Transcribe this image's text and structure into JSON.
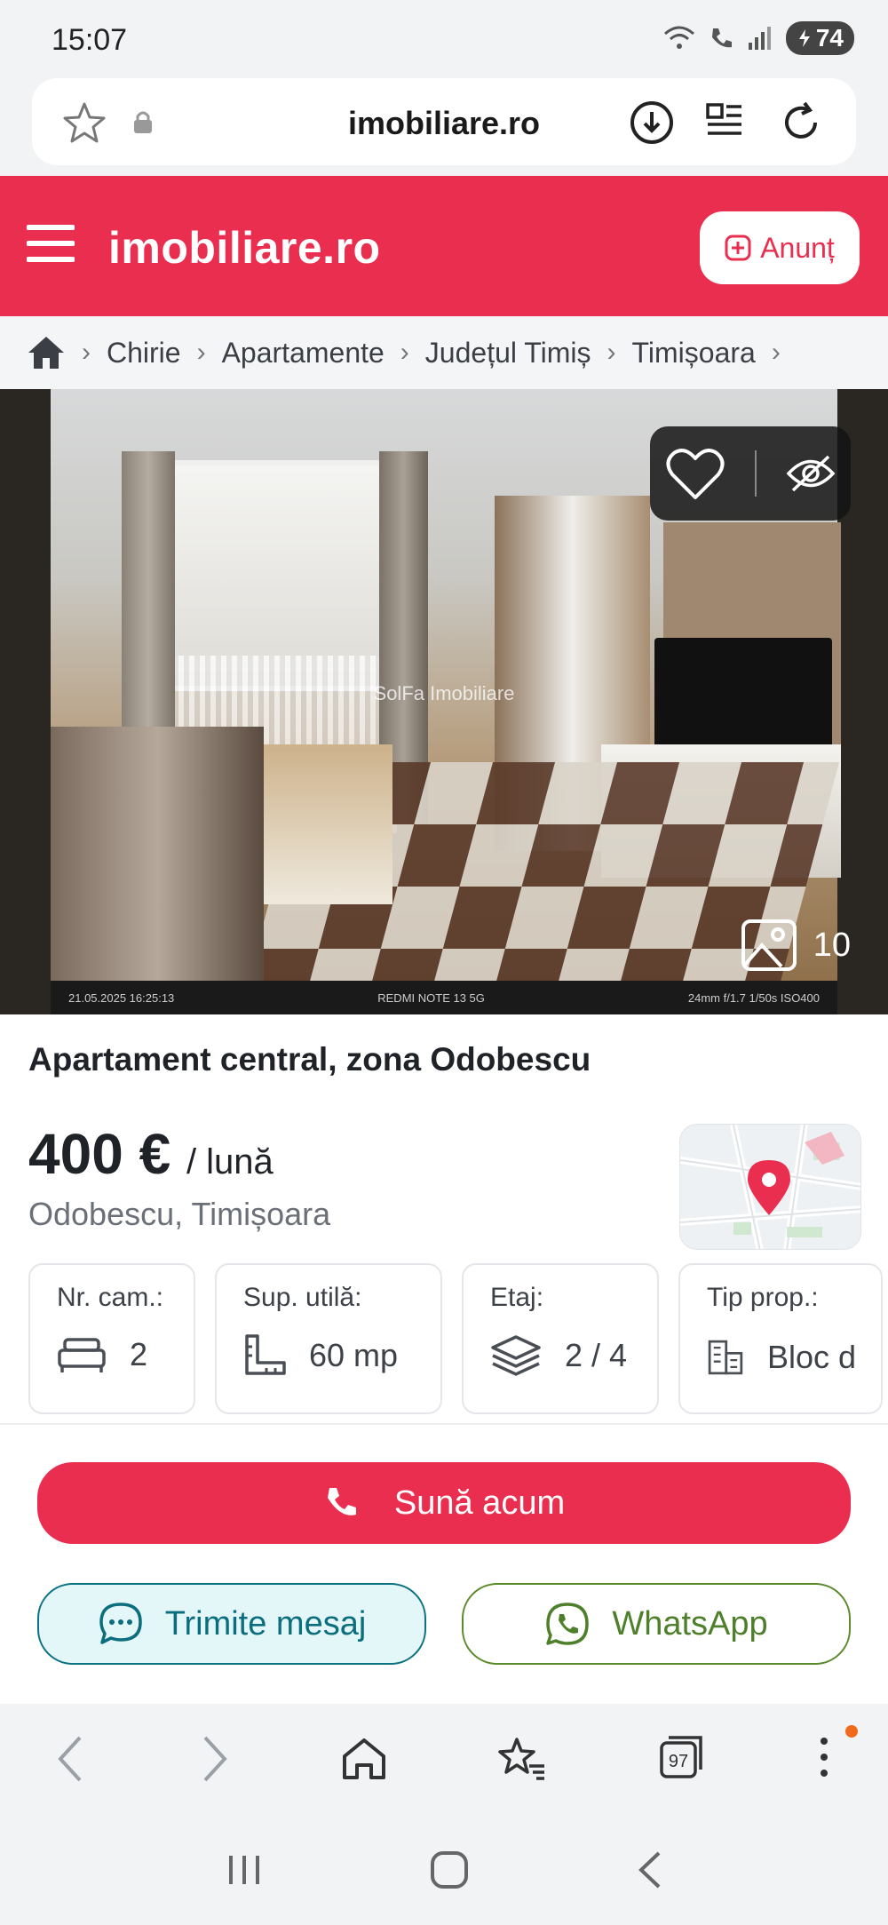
{
  "status_bar": {
    "time": "15:07",
    "battery": "74",
    "icons": [
      "wifi-calling-icon",
      "volte-icon",
      "signal-icon",
      "battery-icon"
    ]
  },
  "browser": {
    "url": "imobiliare.ro",
    "icons": [
      "star-icon",
      "lock-icon",
      "download-icon",
      "reader-mode-icon",
      "reload-icon"
    ]
  },
  "site_header": {
    "logo_text": "imobiliare.ro",
    "post_button_label": "Anunț",
    "brand_color": "#ea2e4f"
  },
  "breadcrumb": {
    "items": [
      "Chirie",
      "Apartamente",
      "Județul Timiș",
      "Timișoara"
    ]
  },
  "gallery": {
    "watermark": "SolFa Imobiliare",
    "photo_count": "10",
    "exif_left": "21.05.2025  16:25:13",
    "exif_center": "REDMI NOTE 13 5G",
    "exif_right": "24mm  f/1.7  1/50s  ISO400"
  },
  "listing": {
    "title": "Apartament central, zona Odobescu",
    "price": "400 €",
    "price_unit": "/ lună",
    "location": "Odobescu, Timișoara"
  },
  "features": [
    {
      "label": "Nr. cam.:",
      "value": "2",
      "icon": "bed-icon"
    },
    {
      "label": "Sup. utilă:",
      "value": "60 mp",
      "icon": "ruler-icon"
    },
    {
      "label": "Etaj:",
      "value": "2 / 4",
      "icon": "layers-icon"
    },
    {
      "label": "Tip prop.:",
      "value": "Bloc d",
      "icon": "building-icon"
    }
  ],
  "actions": {
    "call": "Sună acum",
    "message": "Trimite mesaj",
    "whatsapp": "WhatsApp"
  },
  "browser_nav": {
    "tabs_count": "97"
  }
}
